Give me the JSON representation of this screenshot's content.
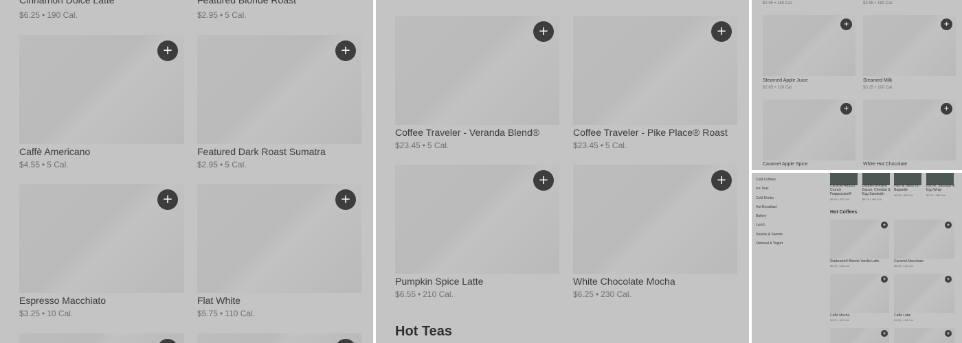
{
  "panel1": {
    "top_items": [
      {
        "name": "Cinnamon Dolce Latte",
        "price": "$6.25",
        "cal": "190 Cal."
      },
      {
        "name": "Featured Blonde Roast",
        "price": "$2.95",
        "cal": "5 Cal."
      }
    ],
    "items": [
      {
        "name": "Caffè Americano",
        "price": "$4.55",
        "cal": "5 Cal."
      },
      {
        "name": "Featured Dark Roast Sumatra",
        "price": "$2.95",
        "cal": "5 Cal."
      },
      {
        "name": "Espresso Macchiato",
        "price": "$3.25",
        "cal": "10 Cal."
      },
      {
        "name": "Flat White",
        "price": "$5.75",
        "cal": "110 Cal."
      }
    ]
  },
  "panel2": {
    "items": [
      {
        "name": "Coffee Traveler - Veranda Blend®",
        "price": "$23.45",
        "cal": "5 Cal."
      },
      {
        "name": "Coffee Traveler - Pike Place® Roast",
        "price": "$23.45",
        "cal": "5 Cal."
      },
      {
        "name": "Pumpkin Spice Latte",
        "price": "$6.55",
        "cal": "210 Cal."
      },
      {
        "name": "White Chocolate Mocha",
        "price": "$6.25",
        "cal": "230 Cal."
      }
    ],
    "section_title": "Hot Teas"
  },
  "panel3": {
    "top_items": [
      {
        "price": "$2.95",
        "cal": "180 Cal."
      },
      {
        "price": "$2.95",
        "cal": "190 Cal."
      }
    ],
    "items": [
      {
        "name": "Steamed Apple Juice",
        "price": "$2.65",
        "cal": "120 Cal."
      },
      {
        "name": "Steamed Milk",
        "price": "$3.15",
        "cal": "100 Cal."
      },
      {
        "name": "Caramel Apple Spice",
        "price": "",
        "cal": ""
      },
      {
        "name": "White Hot Chocolate",
        "price": "",
        "cal": ""
      }
    ]
  },
  "panel4": {
    "nav": [
      "Cold Coffees",
      "Ice Teas",
      "Cold Drinks",
      "Hot Breakfast",
      "Bakery",
      "Lunch",
      "Snacks & Sweets",
      "Oatmeal & Yogurt"
    ],
    "strip_items": [
      {
        "name": "Caramel Ribbon Crunch Frappuccino®",
        "price": "$6.45",
        "cal": "320 Cal."
      },
      {
        "name": "Double-Smoked Bacon, Cheddar & Egg Sandwich",
        "price": "$5.75",
        "cal": "480 Cal."
      },
      {
        "name": "Ham & Swiss on Baguette",
        "price": "$6.75",
        "cal": "350 Cal."
      },
      {
        "name": "Bacon, Sausage & Egg Wrap",
        "price": "$7.55",
        "cal": "480 Cal."
      }
    ],
    "section_title": "Hot Coffees",
    "items": [
      {
        "name": "Starbucks® Blonde Vanilla Latte",
        "price": "$5.75",
        "cal": "180 Cal."
      },
      {
        "name": "Caramel Macchiato",
        "price": "$5.95",
        "cal": "180 Cal."
      },
      {
        "name": "Caffè Mocha",
        "price": "$5.75",
        "cal": "300 Cal."
      },
      {
        "name": "Caffè Latte",
        "price": "$4.95",
        "cal": "180 Cal."
      }
    ]
  },
  "add_icon": "plus-icon",
  "colors": {
    "panel_bg": "#c4c4c4",
    "thumb_bg": "#bcbcbc",
    "add_button": "#3d3d3d"
  }
}
